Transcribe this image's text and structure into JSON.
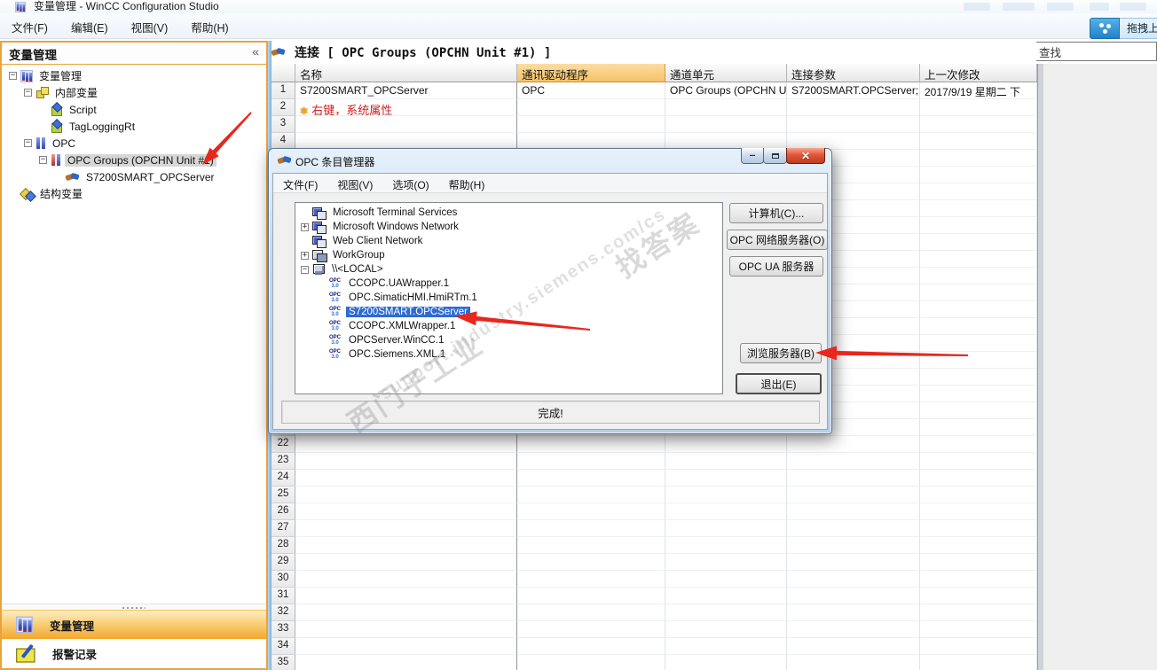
{
  "window": {
    "title": "变量管理 - WinCC Configuration Studio",
    "menu": [
      "文件(F)",
      "编辑(E)",
      "视图(V)",
      "帮助(H)"
    ]
  },
  "topbar": {
    "drag_button_label": "拖拽上",
    "search_value": "查找"
  },
  "sidebar": {
    "header": "变量管理",
    "collapse_glyph": "«",
    "tree": [
      {
        "label": "变量管理",
        "level": 0,
        "expand": "minus",
        "icon": "tag-management-icon",
        "ic": "ic-bars"
      },
      {
        "label": "内部变量",
        "level": 1,
        "expand": "minus",
        "icon": "internal-tags-icon",
        "ic": "ic-cubes"
      },
      {
        "label": "Script",
        "level": 2,
        "expand": "none",
        "icon": "tag-group-icon",
        "ic": "ic-cube"
      },
      {
        "label": "TagLoggingRt",
        "level": 2,
        "expand": "none",
        "icon": "tag-group-icon",
        "ic": "ic-cube"
      },
      {
        "label": "OPC",
        "level": 1,
        "expand": "minus",
        "icon": "opc-channel-icon",
        "ic": "ic-2bars"
      },
      {
        "label": "OPC Groups (OPCHN Unit #1)",
        "level": 2,
        "expand": "minus",
        "icon": "opc-unit-icon",
        "ic": "ic-2bars red",
        "selected": true
      },
      {
        "label": "S7200SMART_OPCServer",
        "level": 3,
        "expand": "none",
        "icon": "connection-icon",
        "ic": "ic-hand"
      },
      {
        "label": "结构变量",
        "level": 0,
        "expand": "none",
        "icon": "structure-tags-icon",
        "ic": "ic-struct"
      }
    ],
    "footer_items": [
      {
        "label": "变量管理",
        "active": true,
        "icon": "tag-management-icon",
        "ic": "ic-bars"
      },
      {
        "label": "报警记录",
        "active": false,
        "icon": "alarm-logging-icon",
        "ic": "ic-alarm"
      }
    ]
  },
  "grid": {
    "section_title": "连接 [ OPC Groups (OPCHN Unit #1) ]",
    "columns": [
      "名称",
      "通讯驱动程序",
      "通道单元",
      "连接参数",
      "上一次修改"
    ],
    "highlighted_column": "通讯驱动程序",
    "row_count": 35,
    "rows": [
      {
        "n": 1,
        "cells": [
          "S7200SMART_OPCServer",
          "OPC",
          "OPC Groups (OPCHN Un",
          "S7200SMART.OPCServer;",
          "2017/9/19 星期二 下"
        ]
      },
      {
        "n": 2,
        "note": "右键，系统属性",
        "note_icon": "red-annotation-star-icon"
      }
    ]
  },
  "dialog": {
    "title": "OPC 条目管理器",
    "menu": [
      "文件(F)",
      "视图(V)",
      "选项(O)",
      "帮助(H)"
    ],
    "window_buttons": {
      "minimize": "—",
      "maximize": "□",
      "close": "✕"
    },
    "tree": [
      {
        "label": "Microsoft Terminal Services",
        "level": 0,
        "expand": "none",
        "icon": "network-icon",
        "ic": "ic-network"
      },
      {
        "label": "Microsoft Windows Network",
        "level": 0,
        "expand": "plus",
        "icon": "network-icon",
        "ic": "ic-network"
      },
      {
        "label": "Web Client Network",
        "level": 0,
        "expand": "none",
        "icon": "network-icon",
        "ic": "ic-network"
      },
      {
        "label": "WorkGroup",
        "level": 0,
        "expand": "plus",
        "icon": "workgroup-icon",
        "ic": "ic-workgroup"
      },
      {
        "label": "\\\\<LOCAL>",
        "level": 0,
        "expand": "minus",
        "icon": "computer-icon",
        "ic": "ic-computer"
      },
      {
        "label": "CCOPC.UAWrapper.1",
        "level": 1,
        "expand": "none",
        "icon": "opc30-icon",
        "ic": "ic-opc30"
      },
      {
        "label": "OPC.SimaticHMI.HmiRTm.1",
        "level": 1,
        "expand": "none",
        "icon": "opc30-icon",
        "ic": "ic-opc30"
      },
      {
        "label": "S7200SMART.OPCServer",
        "level": 1,
        "expand": "none",
        "icon": "opc30-icon",
        "ic": "ic-opc30",
        "selected": true
      },
      {
        "label": "CCOPC.XMLWrapper.1",
        "level": 1,
        "expand": "none",
        "icon": "opc30-icon",
        "ic": "ic-opc30"
      },
      {
        "label": "OPCServer.WinCC.1",
        "level": 1,
        "expand": "none",
        "icon": "opc30-icon",
        "ic": "ic-opc30"
      },
      {
        "label": "OPC.Siemens.XML.1",
        "level": 1,
        "expand": "none",
        "icon": "opc30-icon",
        "ic": "ic-opc30"
      }
    ],
    "buttons": [
      "计算机(C)...",
      "OPC 网络服务器(O)",
      "OPC UA 服务器",
      "浏览服务器(B)",
      "退出(E)"
    ],
    "status": "完成!"
  },
  "watermark": {
    "texts": [
      "西门子工业",
      "找答案",
      "support.industry.siemens.com/cs"
    ]
  },
  "annotations": {
    "arrow_color": "#e8271d"
  }
}
